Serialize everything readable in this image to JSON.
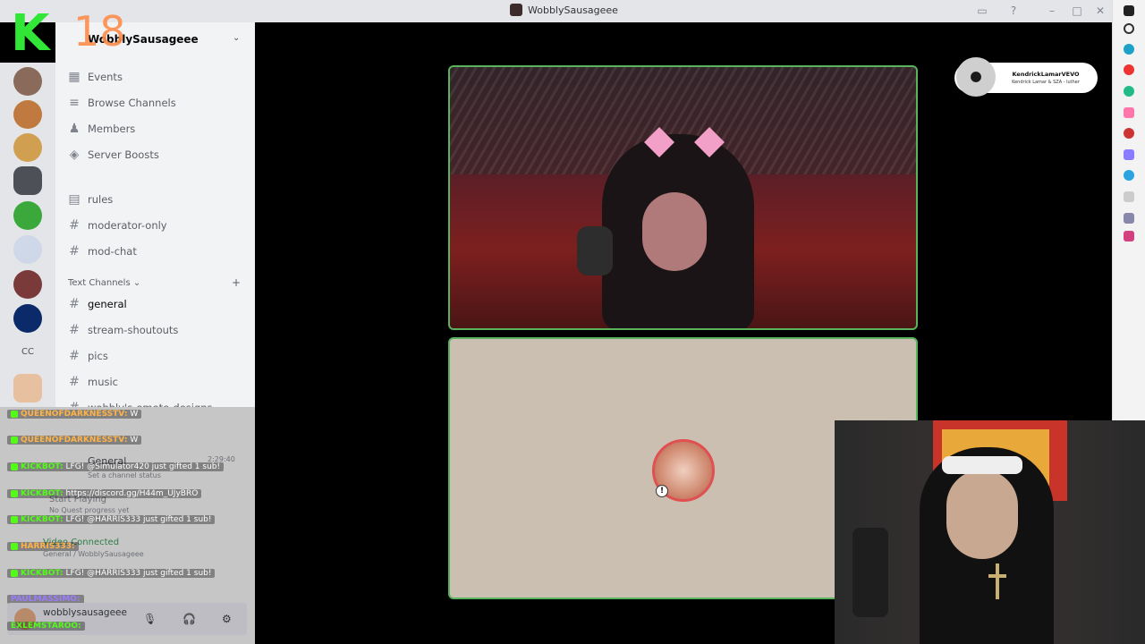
{
  "window": {
    "title": "WobblySausageee"
  },
  "overlay": {
    "logo_letter": "K",
    "logo_number": "18"
  },
  "server": {
    "name": "WobblySausageee"
  },
  "menu_items": [
    {
      "label": "Events"
    },
    {
      "label": "Browse Channels"
    },
    {
      "label": "Members"
    },
    {
      "label": "Server Boosts"
    }
  ],
  "top_channels": [
    {
      "label": "rules"
    },
    {
      "label": "moderator-only"
    },
    {
      "label": "mod-chat"
    }
  ],
  "text_category": {
    "label": "Text Channels"
  },
  "text_channels": [
    {
      "label": "general"
    },
    {
      "label": "stream-shoutouts"
    },
    {
      "label": "pics"
    },
    {
      "label": "music"
    },
    {
      "label": "wobbly's-emote-designs"
    }
  ],
  "rail": {
    "cc_label": "CC"
  },
  "voice": {
    "channel": "General",
    "status": "Set a channel status",
    "playing_title": "Start Playing",
    "playing_sub": "No Quest progress yet",
    "connected": "Video Connected",
    "connected_sub": "General / WobblySausageee",
    "time": "2:29:40"
  },
  "chat": [
    {
      "name": "QUEENOFDARKNESSTV:",
      "text": "W",
      "color": "#ffb347"
    },
    {
      "name": "QUEENOFDARKNESSTV:",
      "text": "W",
      "color": "#ffb347"
    },
    {
      "name": "KICKBOT:",
      "text": "LFG! @Simulator420 just gifted 1 sub!",
      "color": "#53fc18"
    },
    {
      "name": "KICKBOT:",
      "text": "https://discord.gg/H44m_UJyBRO",
      "color": "#53fc18"
    },
    {
      "name": "KICKBOT:",
      "text": "LFG! @HARRIS333 just gifted 1 sub!",
      "color": "#53fc18"
    },
    {
      "name": "HARRIS333:",
      "text": "",
      "color": "#ffb347"
    },
    {
      "name": "KICKBOT:",
      "text": "LFG! @HARRIS333 just gifted 1 sub!",
      "color": "#53fc18"
    },
    {
      "name": "PAULMASSIMO:",
      "text": "",
      "color": "#9b7cff"
    },
    {
      "name": "EXLEMSTAROO:",
      "text": "",
      "color": "#53fc18"
    }
  ],
  "user": {
    "name": "wobblysausageee"
  },
  "now_playing": {
    "artist": "KendrickLamarVEVO",
    "track": "Kendrick Lamar & SZA - luther"
  },
  "colors": {
    "accent_green": "#59b35d",
    "kick_green": "#53fc18"
  }
}
